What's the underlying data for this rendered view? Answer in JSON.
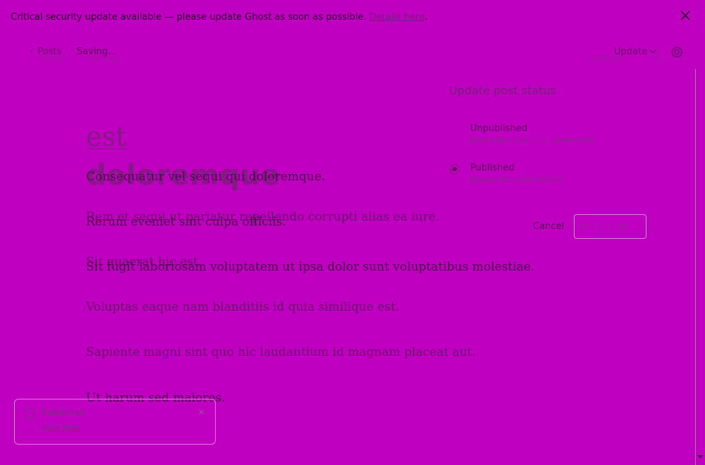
{
  "banner": {
    "text": "Critical security update available — please update Ghost as soon as possible.",
    "link": "Details here",
    "trailing": "."
  },
  "header": {
    "back_label": "Posts",
    "saving_label": "Saving...",
    "update_label": "Update"
  },
  "post": {
    "title": "est",
    "title_ghost": "doloremque",
    "paragraphs": [
      "Consequatur vel sequi qui doloremque.",
      "Rerum eveniet sint culpa officiis.",
      "Sit fugit laboriosam voluptatem ut ipsa dolor sunt voluptatibus molestiae.",
      "Voluptas eaque nam blanditiis id quia similique est.",
      "Sapiente magni sint quo hic laudantium id magnam placeat aut.",
      "Ut harum sed maiores."
    ],
    "ghost_paragraphs": [
      "Rem et sequi ut pariatur repellendo corrupti alias ea iure.",
      "Sit quaerat hic est."
    ]
  },
  "status_popover": {
    "title": "Update post status",
    "options": [
      {
        "label": "Unpublished",
        "desc": "Revert this post to a private draft",
        "selected": false
      },
      {
        "label": "Published",
        "desc": "Display this post publicly",
        "selected": true
      }
    ],
    "cancel_label": "Cancel",
    "confirm_label": "Unpublish"
  },
  "toast": {
    "title": "Published",
    "link": "View Post"
  }
}
